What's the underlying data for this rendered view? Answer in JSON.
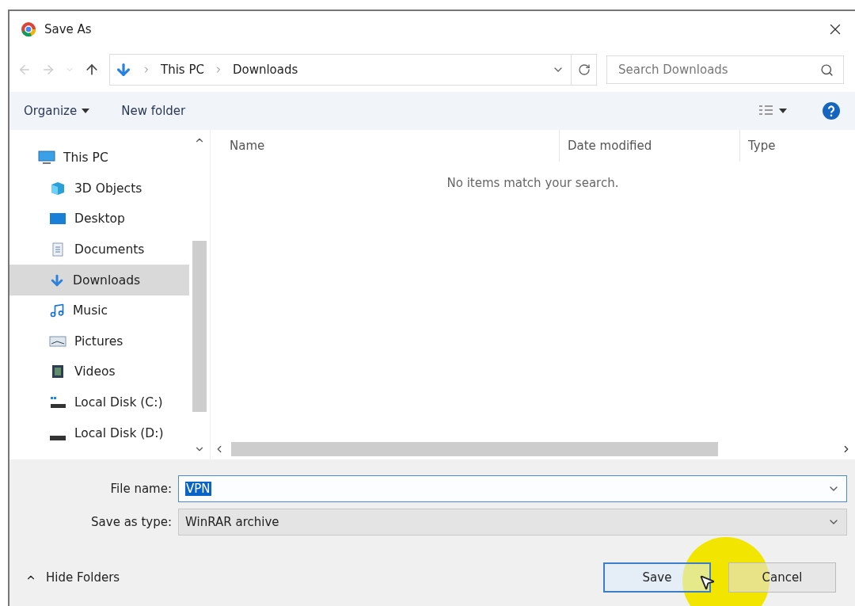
{
  "window": {
    "title": "Save As"
  },
  "address_bar": {
    "path": [
      "This PC",
      "Downloads"
    ]
  },
  "search": {
    "placeholder": "Search Downloads"
  },
  "command_bar": {
    "organize": "Organize",
    "new_folder": "New folder"
  },
  "sidebar": {
    "items": [
      {
        "label": "This PC",
        "selected": false,
        "children": [
          {
            "label": "3D Objects",
            "selected": false
          },
          {
            "label": "Desktop",
            "selected": false
          },
          {
            "label": "Documents",
            "selected": false
          },
          {
            "label": "Downloads",
            "selected": true
          },
          {
            "label": "Music",
            "selected": false
          },
          {
            "label": "Pictures",
            "selected": false
          },
          {
            "label": "Videos",
            "selected": false
          },
          {
            "label": "Local Disk (C:)",
            "selected": false
          },
          {
            "label": "Local Disk (D:)",
            "selected": false
          }
        ]
      }
    ]
  },
  "file_list": {
    "columns": [
      "Name",
      "Date modified",
      "Type"
    ],
    "empty_message": "No items match your search."
  },
  "file_name": {
    "label": "File name:",
    "value": "VPN",
    "selected": true
  },
  "save_as_type": {
    "label": "Save as type:",
    "value": "WinRAR archive"
  },
  "hide_folders": "Hide Folders",
  "buttons": [
    {
      "label": "Save",
      "kind": "primary"
    },
    {
      "label": "Cancel",
      "kind": "secondary"
    }
  ]
}
